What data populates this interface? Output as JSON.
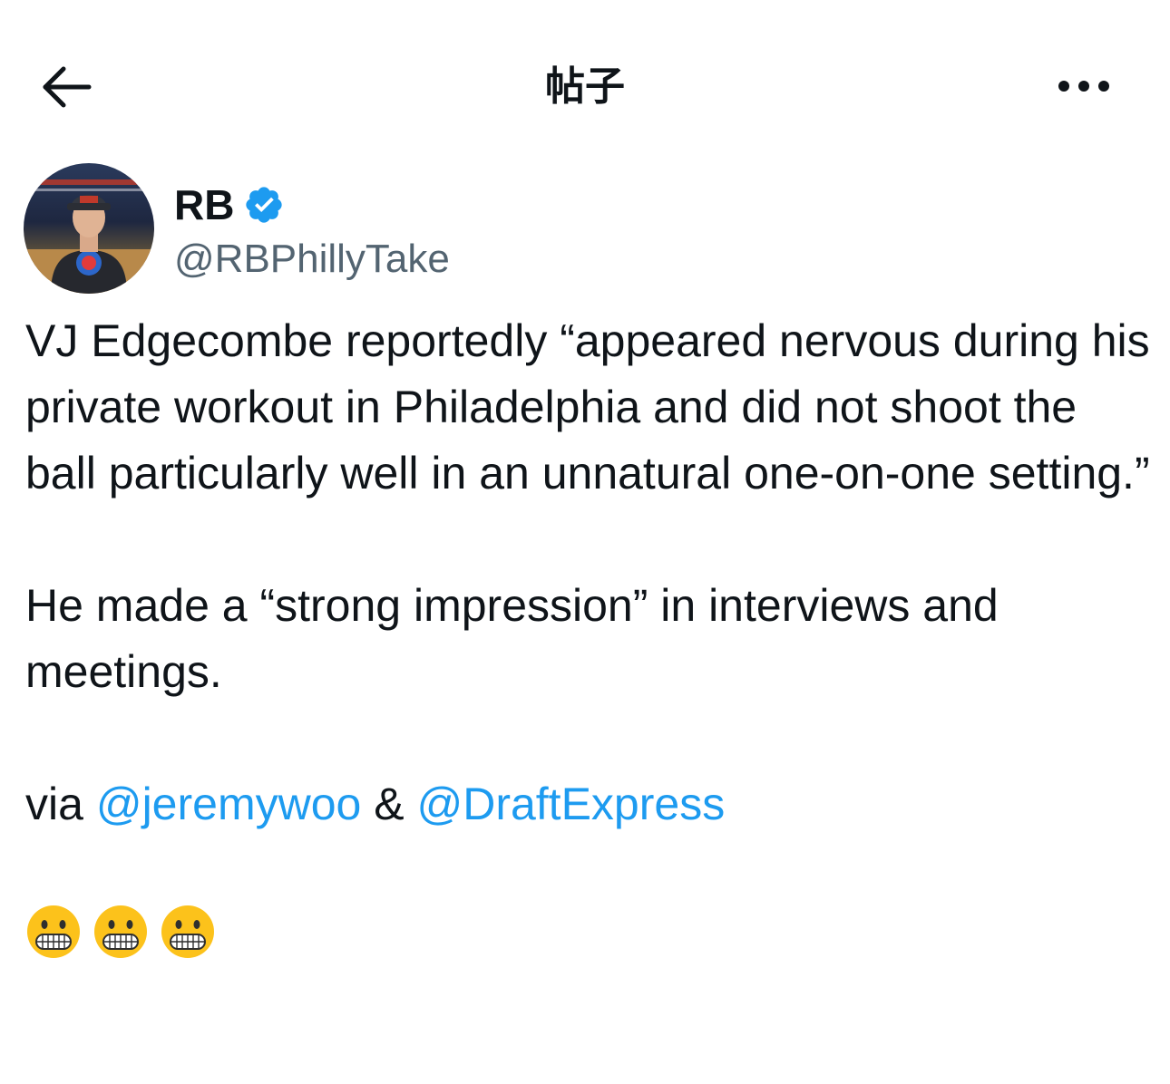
{
  "header": {
    "title": "帖子",
    "back_icon": "arrow-left-icon",
    "more_icon": "more-horizontal-icon"
  },
  "author": {
    "display_name": "RB",
    "handle": "@RBPhillyTake",
    "verified_icon": "verified-badge-icon",
    "verified_color": "#1d9bf0"
  },
  "tweet": {
    "paragraph1": "VJ Edgecombe reportedly “appeared nervous during his private workout in Philadelphia and did not shoot the ball particularly well in an unnatural one-on-one setting.”",
    "paragraph2": "He made a “strong impression” in interviews and meetings.",
    "via_prefix": "via ",
    "mention1": "@jeremywoo",
    "ampersand": " & ",
    "mention2": "@DraftExpress",
    "emojis": [
      "😬",
      "😬",
      "😬"
    ],
    "mention_color": "#1d9bf0"
  }
}
